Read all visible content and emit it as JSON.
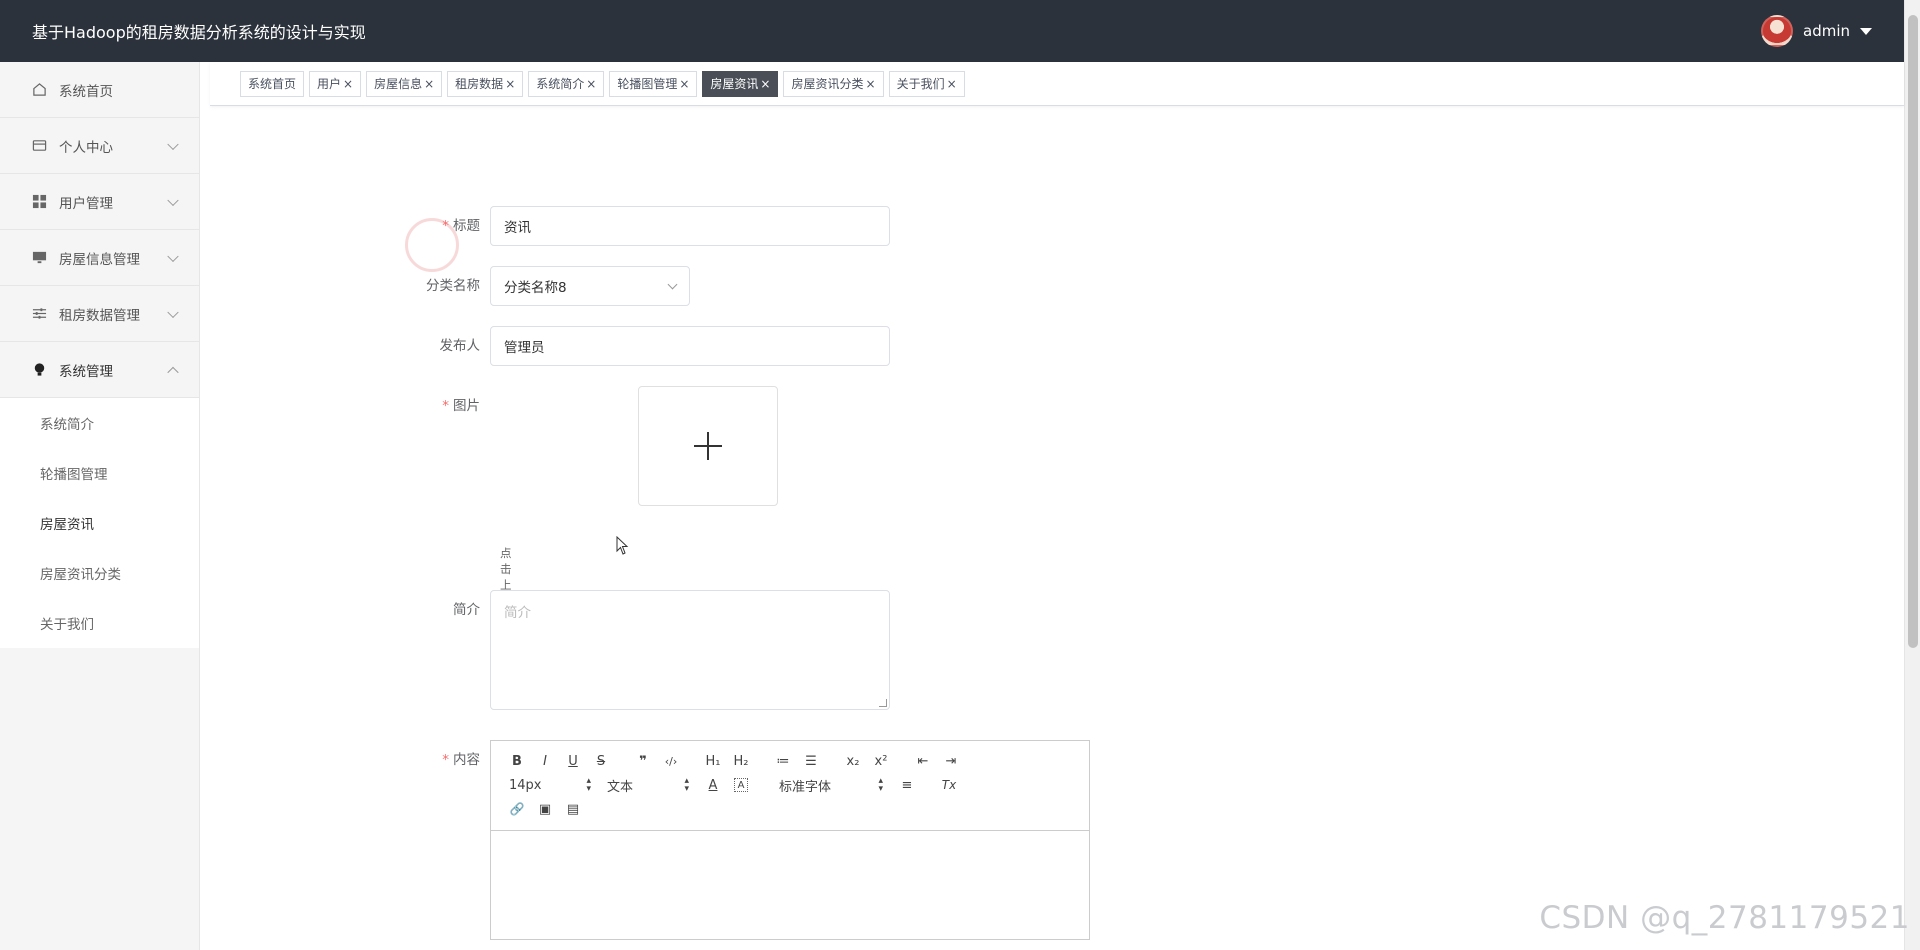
{
  "header": {
    "title": "基于Hadoop的租房数据分析系统的设计与实现",
    "username": "admin"
  },
  "sidebar": {
    "items": [
      {
        "label": "系统首页",
        "icon": "home-icon"
      },
      {
        "label": "个人中心",
        "icon": "wallet-icon"
      },
      {
        "label": "用户管理",
        "icon": "grid-icon"
      },
      {
        "label": "房屋信息管理",
        "icon": "monitor-icon"
      },
      {
        "label": "租房数据管理",
        "icon": "sliders-icon"
      },
      {
        "label": "系统管理",
        "icon": "bulb-icon"
      }
    ],
    "submenu": [
      "系统简介",
      "轮播图管理",
      "房屋资讯",
      "房屋资讯分类",
      "关于我们"
    ]
  },
  "tabs": [
    {
      "label": "系统首页",
      "close": ""
    },
    {
      "label": "用户",
      "close": "×"
    },
    {
      "label": "房屋信息",
      "close": "×"
    },
    {
      "label": "租房数据",
      "close": "×"
    },
    {
      "label": "系统简介",
      "close": "×"
    },
    {
      "label": "轮播图管理",
      "close": "×"
    },
    {
      "label": "房屋资讯",
      "close": "×"
    },
    {
      "label": "房屋资讯分类",
      "close": "×"
    },
    {
      "label": "关于我们",
      "close": "×"
    }
  ],
  "form": {
    "required_mark": "*",
    "title_label": "标题",
    "title_value": "资讯",
    "category_label": "分类名称",
    "category_value": "分类名称8",
    "publisher_label": "发布人",
    "publisher_value": "管理员",
    "image_label": "图片",
    "upload_hint": "点击上传图片",
    "intro_label": "简介",
    "intro_placeholder": "简介",
    "content_label": "内容"
  },
  "editor": {
    "row1": [
      "B",
      "I",
      "U",
      "S",
      "❞",
      "‹/›",
      "H₁",
      "H₂",
      "≔",
      "☰",
      "x₂",
      "x²",
      "⇤",
      "⇥"
    ],
    "font_size": "14px",
    "header_select": "文本",
    "text_color": "A",
    "bg_color": "A",
    "font_family": "标准字体",
    "align": "≡",
    "clean": "Tx",
    "row3": [
      "🔗",
      "▣",
      "▤"
    ]
  },
  "watermark": "CSDN @q_2781179521",
  "colors": {
    "header_bg": "#2b323b",
    "active_tab": "#4a4f57",
    "required": "#f56c6c"
  }
}
